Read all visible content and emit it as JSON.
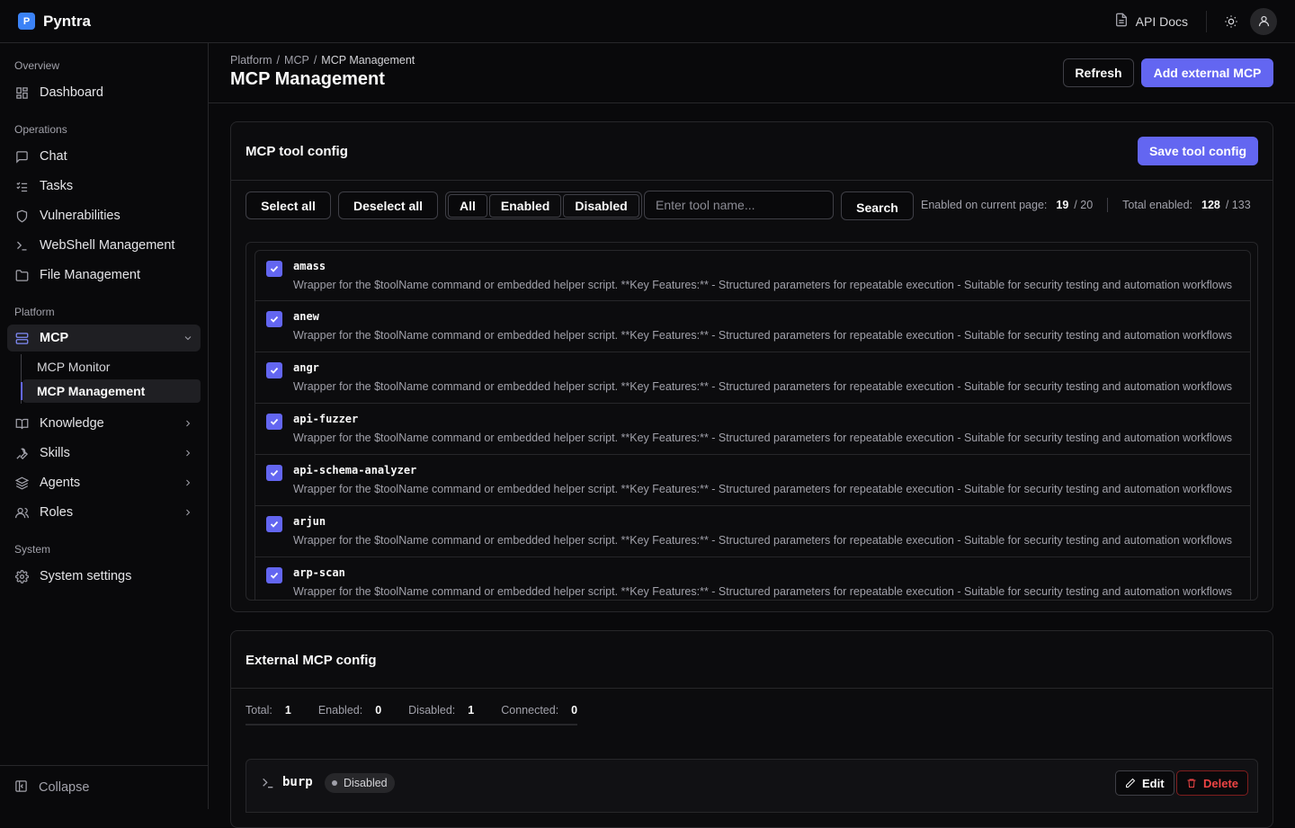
{
  "app": {
    "name": "Pyntra",
    "logo_letter": "P"
  },
  "topbar": {
    "api_docs": "API Docs"
  },
  "sidebar": {
    "sections": {
      "overview": "Overview",
      "operations": "Operations",
      "platform": "Platform",
      "system": "System"
    },
    "items": {
      "dashboard": "Dashboard",
      "chat": "Chat",
      "tasks": "Tasks",
      "vulnerabilities": "Vulnerabilities",
      "webshell": "WebShell Management",
      "files": "File Management",
      "mcp": "MCP",
      "mcp_monitor": "MCP Monitor",
      "mcp_management": "MCP Management",
      "knowledge": "Knowledge",
      "skills": "Skills",
      "agents": "Agents",
      "roles": "Roles",
      "system_settings": "System settings"
    },
    "collapse": "Collapse"
  },
  "header": {
    "breadcrumb": [
      "Platform",
      "MCP",
      "MCP Management"
    ],
    "breadcrumb_sep": "/",
    "title": "MCP Management",
    "refresh": "Refresh",
    "add_external": "Add external MCP"
  },
  "tool_config": {
    "title": "MCP tool config",
    "save": "Save tool config",
    "select_all": "Select all",
    "deselect_all": "Deselect all",
    "filters": [
      "All",
      "Enabled",
      "Disabled"
    ],
    "selected_filter": "All",
    "search_placeholder": "Enter tool name...",
    "search_button": "Search",
    "stats": {
      "page_label": "Enabled on current page:",
      "page_enabled": "19",
      "page_total": "/ 20",
      "total_label": "Total enabled:",
      "total_enabled": "128",
      "total_count": "/ 133"
    },
    "tools": [
      {
        "name": "amass",
        "checked": true,
        "desc": "Wrapper for the $toolName command or embedded helper script. **Key Features:** - Structured parameters for repeatable execution - Suitable for security testing and automation workflows"
      },
      {
        "name": "anew",
        "checked": true,
        "desc": "Wrapper for the $toolName command or embedded helper script. **Key Features:** - Structured parameters for repeatable execution - Suitable for security testing and automation workflows"
      },
      {
        "name": "angr",
        "checked": true,
        "desc": "Wrapper for the $toolName command or embedded helper script. **Key Features:** - Structured parameters for repeatable execution - Suitable for security testing and automation workflows"
      },
      {
        "name": "api-fuzzer",
        "checked": true,
        "desc": "Wrapper for the $toolName command or embedded helper script. **Key Features:** - Structured parameters for repeatable execution - Suitable for security testing and automation workflows"
      },
      {
        "name": "api-schema-analyzer",
        "checked": true,
        "desc": "Wrapper for the $toolName command or embedded helper script. **Key Features:** - Structured parameters for repeatable execution - Suitable for security testing and automation workflows"
      },
      {
        "name": "arjun",
        "checked": true,
        "desc": "Wrapper for the $toolName command or embedded helper script. **Key Features:** - Structured parameters for repeatable execution - Suitable for security testing and automation workflows"
      },
      {
        "name": "arp-scan",
        "checked": true,
        "desc": "Wrapper for the $toolName command or embedded helper script. **Key Features:** - Structured parameters for repeatable execution - Suitable for security testing and automation workflows"
      }
    ]
  },
  "external_config": {
    "title": "External MCP config",
    "stats": [
      {
        "label": "Total:",
        "value": "1"
      },
      {
        "label": "Enabled:",
        "value": "0"
      },
      {
        "label": "Disabled:",
        "value": "1"
      },
      {
        "label": "Connected:",
        "value": "0"
      }
    ],
    "servers": [
      {
        "name": "burp",
        "status": "Disabled",
        "edit": "Edit",
        "delete": "Delete"
      }
    ]
  },
  "colors": {
    "accent": "#6366f1",
    "background": "#09090b",
    "border": "#27272a",
    "danger": "#ef4444",
    "brand": "#3b82f6"
  }
}
